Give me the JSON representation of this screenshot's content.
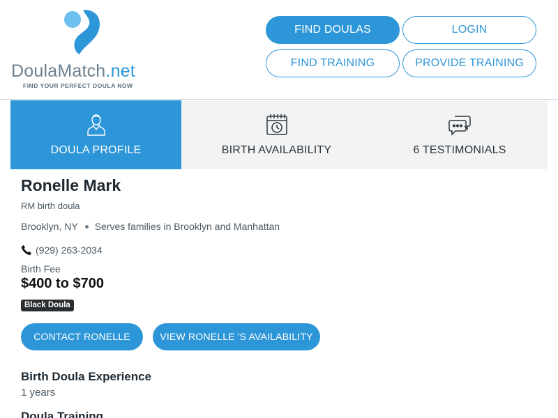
{
  "header": {
    "logo": {
      "brand_part1": "Doula",
      "brand_part2": "Match",
      "brand_part3": ".net",
      "tagline": "FIND YOUR PERFECT DOULA NOW"
    },
    "nav": {
      "find_doulas": "FIND DOULAS",
      "login": "LOGIN",
      "find_training": "FIND TRAINING",
      "provide_training": "PROVIDE TRAINING"
    }
  },
  "tabs": [
    {
      "label": "DOULA PROFILE",
      "icon": "person-icon",
      "active": true
    },
    {
      "label": "BIRTH AVAILABILITY",
      "icon": "calendar-clock-icon",
      "active": false
    },
    {
      "label": "6 TESTIMONIALS",
      "icon": "chat-bubbles-icon",
      "active": false
    }
  ],
  "profile": {
    "name": "Ronelle Mark",
    "business": "RM birth doula",
    "location": "Brooklyn, NY",
    "serves": "Serves families in Brooklyn and Manhattan",
    "phone": "(929) 263-2034",
    "fee_label": "Birth Fee",
    "fee_value": "$400 to $700",
    "badge": "Black Doula",
    "contact_button": "CONTACT RONELLE",
    "availability_button": "VIEW RONELLE 'S AVAILABILITY"
  },
  "sections": {
    "experience_title": "Birth Doula Experience",
    "experience_value": "1 years",
    "training_title": "Doula Training"
  },
  "colors": {
    "accent": "#2d96d8",
    "tab_bg": "#f3f3f3",
    "badge_bg": "#2b2e31"
  }
}
